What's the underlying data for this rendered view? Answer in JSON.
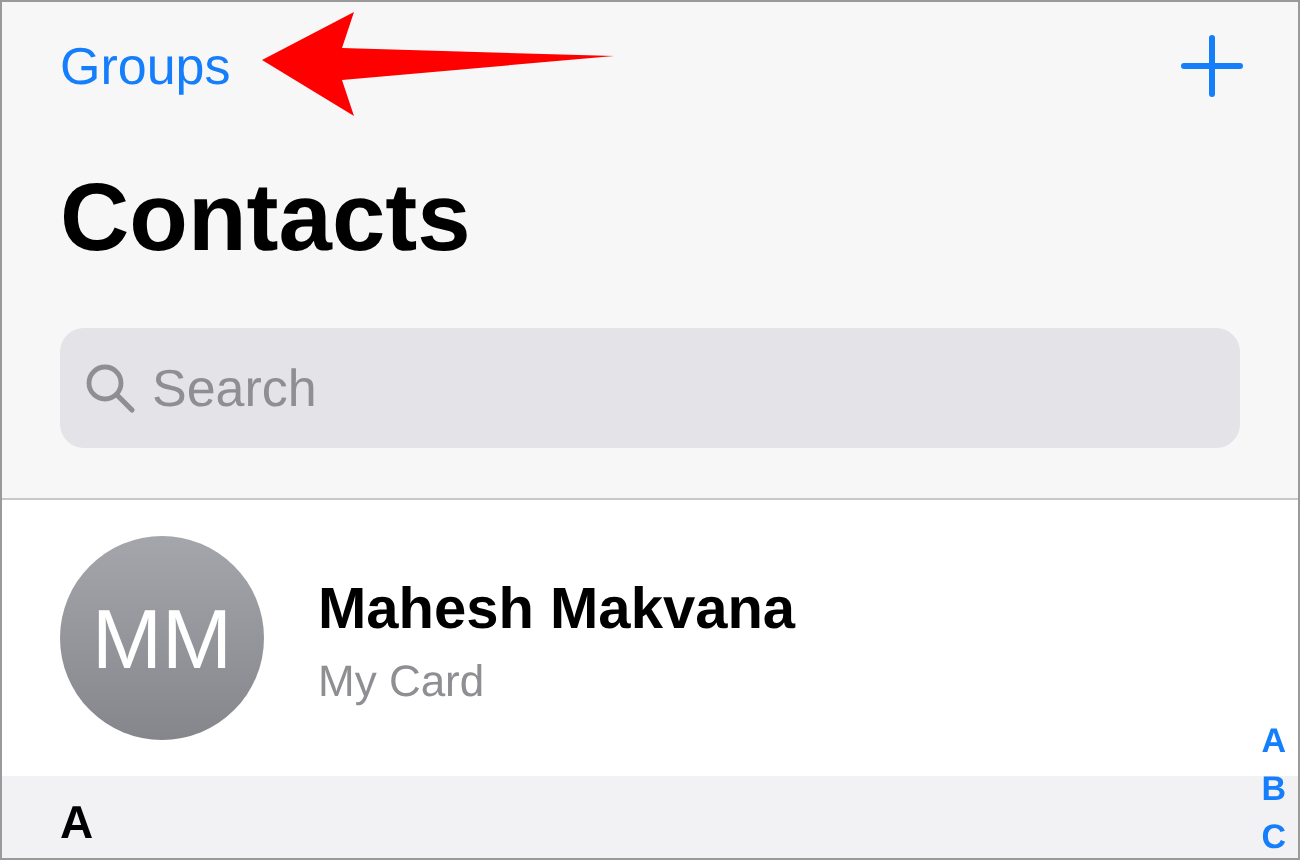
{
  "nav": {
    "groups_label": "Groups"
  },
  "title": "Contacts",
  "search": {
    "placeholder": "Search"
  },
  "my_card": {
    "initials": "MM",
    "name": "Mahesh Makvana",
    "subtitle": "My Card"
  },
  "section_header": "A",
  "index": [
    "A",
    "B",
    "C"
  ]
}
